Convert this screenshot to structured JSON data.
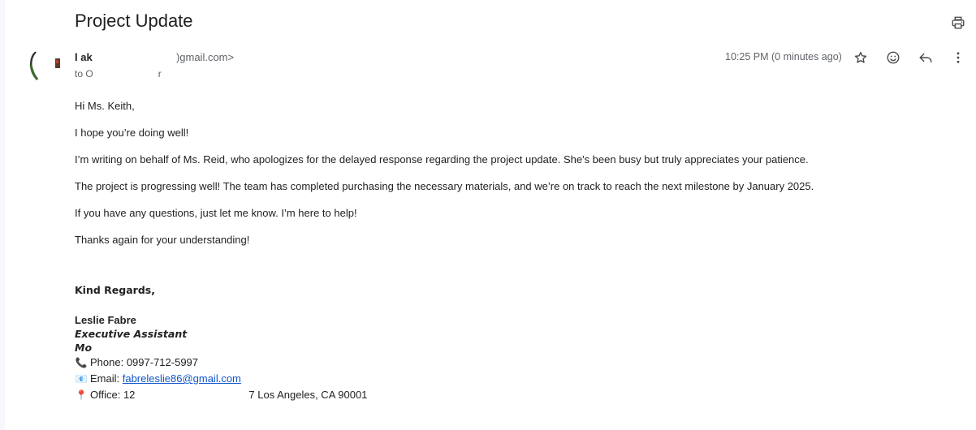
{
  "email": {
    "subject": "Project Update",
    "sender": {
      "name_visible": "l ak",
      "email_suffix": ")gmail.com>"
    },
    "recipient": {
      "prefix": "to O",
      "suffix": "r"
    },
    "timestamp": "10:25 PM (0 minutes ago)",
    "icons": {
      "print": "print-icon",
      "star": "star-icon",
      "emoji": "emoji-react-icon",
      "reply": "reply-icon",
      "more": "more-vert-icon"
    },
    "body": [
      "Hi Ms. Keith,",
      "I hope you’re doing well!",
      "I’m writing on behalf of Ms. Reid, who apologizes for the delayed response regarding the project update. She's been busy but truly appreciates your patience.",
      "The project is progressing well! The team has completed purchasing the necessary materials, and we’re on track to reach the next milestone by January 2025.",
      "If you have any questions, just let me know. I’m here to help!",
      "Thanks again for your understanding!"
    ],
    "signature": {
      "closing": "Kind Regards,",
      "name": "Leslie Fabre",
      "title": "Executive Assistant",
      "company": "Mo",
      "phone_label": "Phone: 0997-712-5997",
      "email_label": "Email: ",
      "email_link": "fabreleslie86@gmail.com",
      "office_prefix": "Office:  12",
      "office_suffix": "7 Los Angeles, CA 90001",
      "phone_emoji": "📞",
      "email_emoji": "📧",
      "office_emoji": "📍"
    }
  }
}
